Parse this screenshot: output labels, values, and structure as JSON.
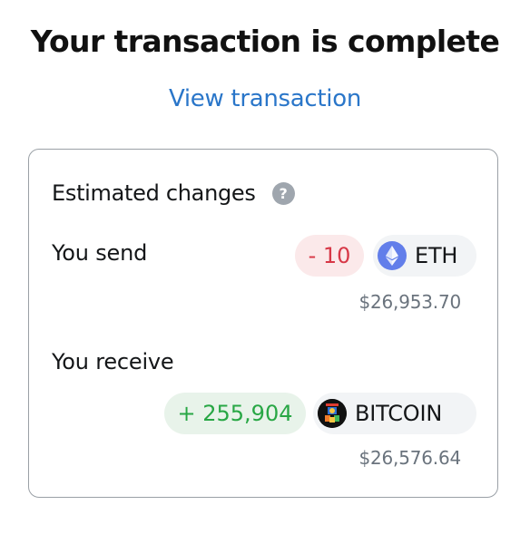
{
  "header": {
    "title": "Your transaction is complete",
    "view_link": "View transaction"
  },
  "estimated_changes": {
    "label": "Estimated changes",
    "help_icon": "question-mark-icon",
    "send": {
      "label": "You send",
      "amount": "- 10",
      "token": "ETH",
      "token_icon": "ethereum-logo-icon",
      "fiat": "$26,953.70",
      "amount_color": "#d73847"
    },
    "receive": {
      "label": "You receive",
      "amount": "+ 255,904",
      "token": "BITCOIN",
      "token_icon": "bitcoin-token-logo-icon",
      "fiat": "$26,576.64",
      "amount_color": "#28a745"
    }
  },
  "colors": {
    "link": "#2a76c9",
    "negative_bg": "#fbe9ea",
    "positive_bg": "#e8f3ea",
    "token_pill_bg": "#f2f4f6",
    "eth_icon_bg": "#627eea"
  }
}
